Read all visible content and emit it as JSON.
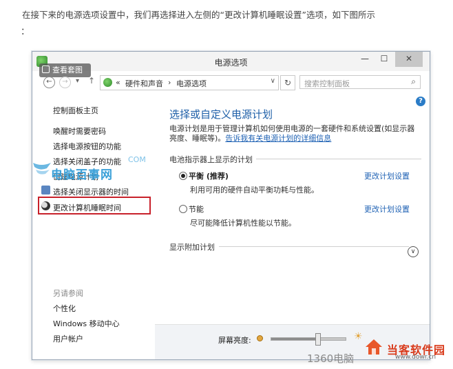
{
  "article": {
    "text": "在接下来的电源选项设置中，我们再选择进入左侧的“更改计算机睡眠设置”选项，如下图所示",
    "colon": "："
  },
  "window": {
    "title": "电源选项",
    "min_glyph": "—",
    "max_glyph": "☐",
    "close_glyph": "✕",
    "view_overlay": "查看套图"
  },
  "nav": {
    "back_glyph": "←",
    "forward_glyph": "→",
    "dropdown_glyph": "▾",
    "up_glyph": "↑",
    "breadcrumb_sep": "«",
    "breadcrumb": [
      "硬件和声音",
      "电源选项"
    ],
    "crumb_arrow": "›",
    "chevron": "∨",
    "refresh_glyph": "↻",
    "search_placeholder": "搜索控制面板",
    "search_glyph": "⌕"
  },
  "help_glyph": "?",
  "sidebar": {
    "items": [
      "控制面板主页",
      "唤醒时需要密码",
      "选择电源按钮的功能",
      "选择关闭盖子的功能",
      "创建电源计划",
      "选择关闭显示器的时间",
      "更改计算机睡眠时间"
    ],
    "see_also_label": "另请参阅",
    "see_also": [
      "个性化",
      "Windows 移动中心",
      "用户帐户"
    ]
  },
  "main": {
    "title": "选择或自定义电源计划",
    "desc": "电源计划是用于管理计算机如何使用电源的一套硬件和系统设置(如显示器亮度、睡眠等)。",
    "desc_link": "告诉我有关电源计划的详细信息",
    "battery_section": "电池指示器上显示的计划",
    "plans": [
      {
        "name": "平衡 (推荐)",
        "desc": "利用可用的硬件自动平衡功耗与性能。",
        "selected": true,
        "link": "更改计划设置"
      },
      {
        "name": "节能",
        "desc": "尽可能降低计算机性能以节能。",
        "selected": false,
        "link": "更改计划设置"
      }
    ],
    "extra_section": "显示附加计划",
    "expand_glyph": "∨"
  },
  "bottom": {
    "brightness_label": "屏幕亮度:",
    "brightness_level": 0.62,
    "sun_glyph": "☀"
  },
  "watermarks": {
    "site1": "电脑百事网",
    "site1_com": "COM",
    "site2": "1360电脑",
    "site2_url": "www.dowr.cn",
    "site3": "当客软件园"
  }
}
